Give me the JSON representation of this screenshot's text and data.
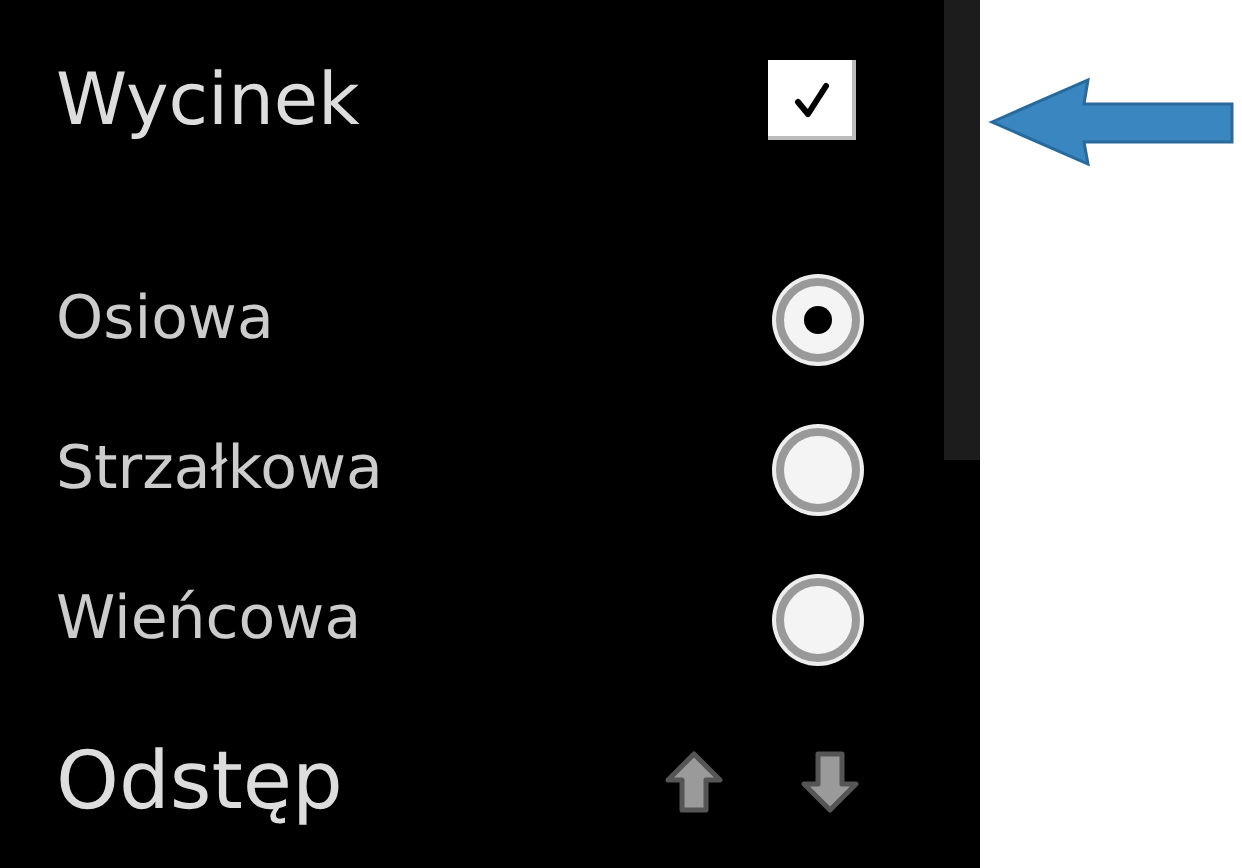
{
  "panel": {
    "slice": {
      "label": "Wycinek",
      "checked": true
    },
    "orientations": [
      {
        "label": "Osiowa",
        "selected": true
      },
      {
        "label": "Strzałkowa",
        "selected": false
      },
      {
        "label": "Wieńcowa",
        "selected": false
      }
    ],
    "spacing": {
      "label": "Odstęp"
    }
  }
}
